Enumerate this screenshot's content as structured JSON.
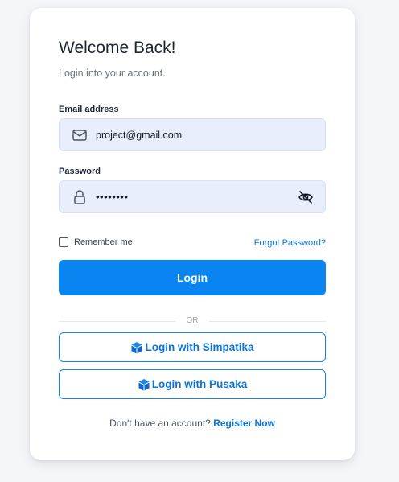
{
  "login": {
    "title": "Welcome Back!",
    "subtitle": "Login into your account.",
    "email_label": "Email address",
    "email_value": "project@gmail.com",
    "email_icon": "mail-icon",
    "password_label": "Password",
    "password_value": "password",
    "password_icon": "lock-icon",
    "toggle_icon": "eye-slash-icon",
    "remember_label": "Remember me",
    "remember_checked": false,
    "forgot_label": "Forgot Password?",
    "login_label": "Login",
    "divider_label": "OR",
    "sso_buttons": [
      {
        "label": "Login with Simpatika",
        "icon": "cube-icon"
      },
      {
        "label": "Login with Pusaka",
        "icon": "cube-icon"
      }
    ],
    "register_prompt": "Don't have an account?",
    "register_link": "Register Now"
  },
  "colors": {
    "accent": "#0a84f0",
    "link": "#0b74d8",
    "field_bg": "#e8eefc",
    "page_bg": "#f4f6f9"
  }
}
